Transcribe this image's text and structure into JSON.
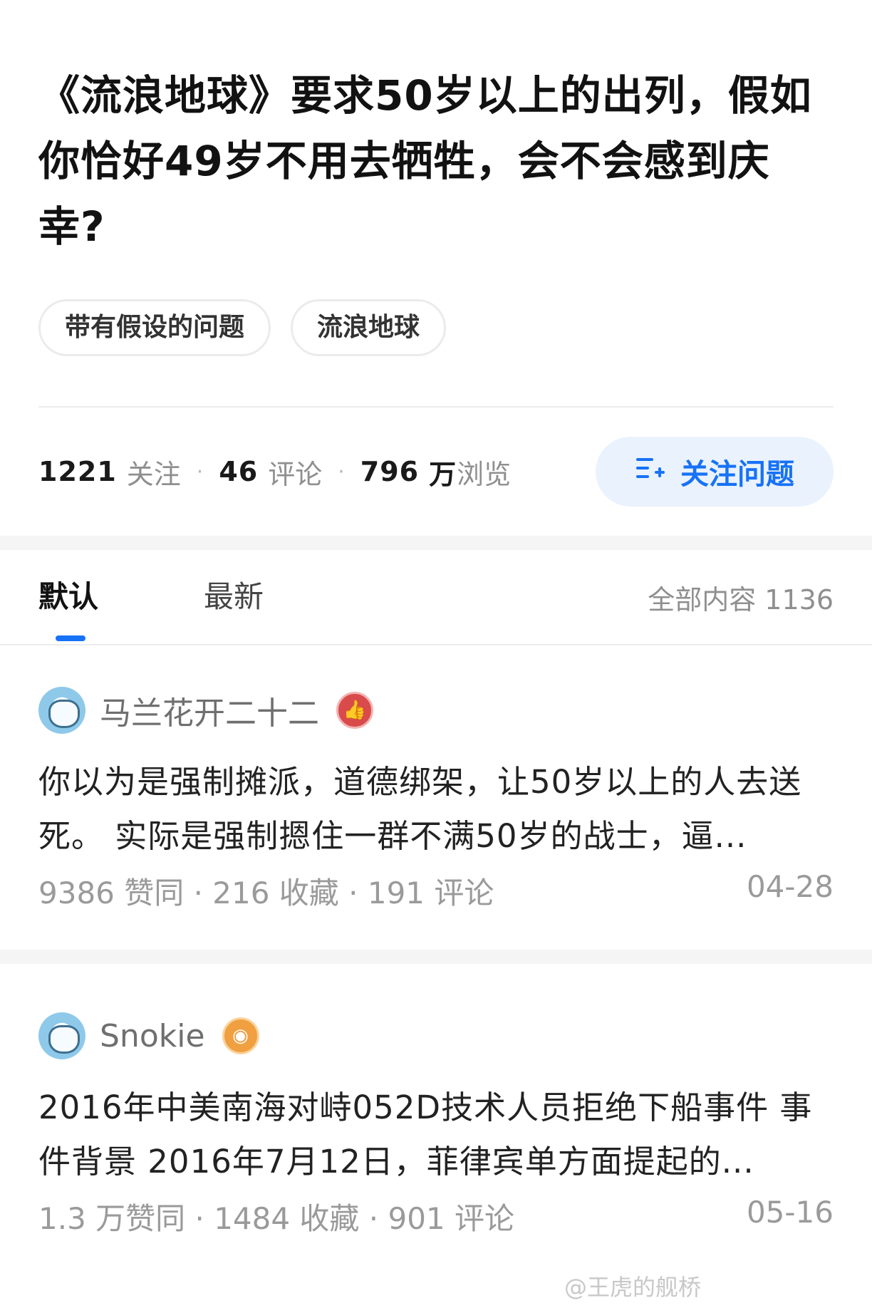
{
  "question": {
    "title": "《流浪地球》要求50岁以上的出列，假如你恰好49岁不用去牺牲，会不会感到庆幸?",
    "tags": [
      "带有假设的问题",
      "流浪地球"
    ]
  },
  "stats": {
    "follow_count": "1221",
    "follow_label": "关注",
    "comment_count": "46",
    "comment_label": "评论",
    "view_count": "796",
    "view_unit": "万",
    "view_label": "浏览",
    "separator": "·"
  },
  "follow_button": {
    "label": "关注问题",
    "icon": "add-list-icon",
    "color": "#1772f6"
  },
  "tabs": [
    {
      "label": "默认",
      "active": true
    },
    {
      "label": "最新",
      "active": false
    }
  ],
  "total_label": "全部内容 1136",
  "answers": [
    {
      "author": "马兰花开二十二",
      "badge_icon": "thumb-up-badge-icon",
      "excerpt": "你以为是强制摊派，道德绑架，让50岁以上的人去送死。 实际是强制摁住一群不满50岁的战士，逼...",
      "meta": "9386 赞同 · 216 收藏 · 191 评论",
      "date": "04-28"
    },
    {
      "author": "Snokie",
      "badge_icon": "eye-badge-icon",
      "excerpt": "2016年中美南海对峙052D技术人员拒绝下船事件 事件背景 2016年7月12日，菲律宾单方面提起的...",
      "meta": "1.3 万赞同 · 1484 收藏 · 901 评论",
      "date": "05-16"
    }
  ],
  "watermark": "@王虎的舰桥"
}
